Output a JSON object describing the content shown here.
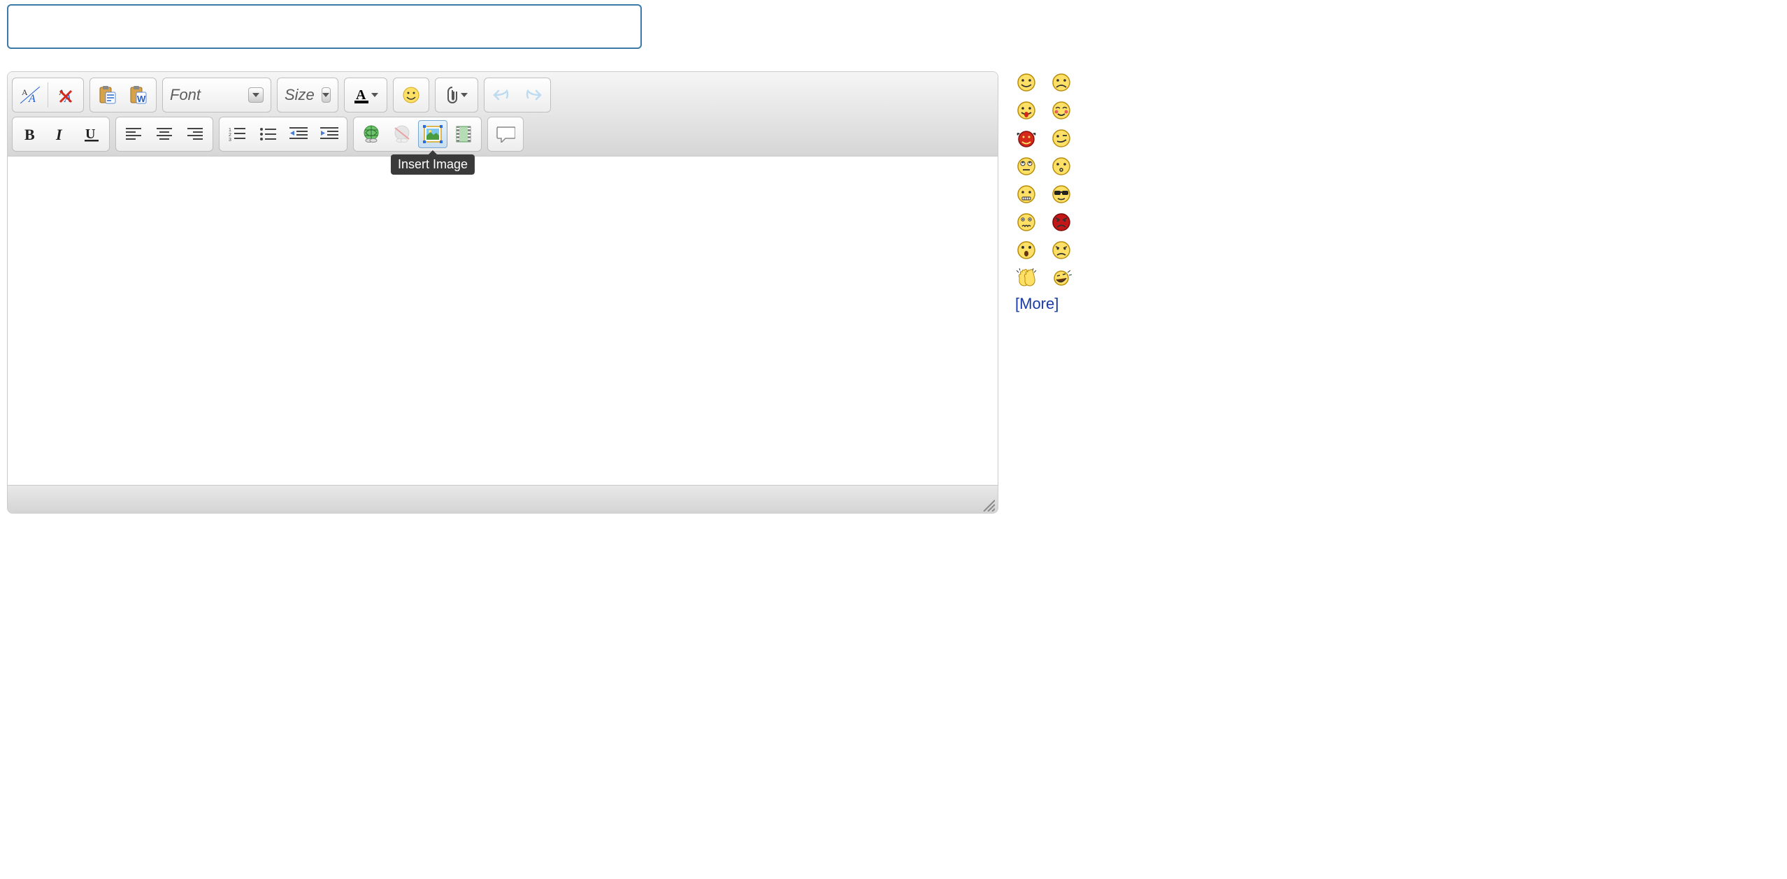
{
  "title": {
    "value": ""
  },
  "toolbar": {
    "font_label": "Font",
    "size_label": "Size",
    "tooltip_insert_image": "Insert Image"
  },
  "smileys": {
    "more_label": "More"
  }
}
